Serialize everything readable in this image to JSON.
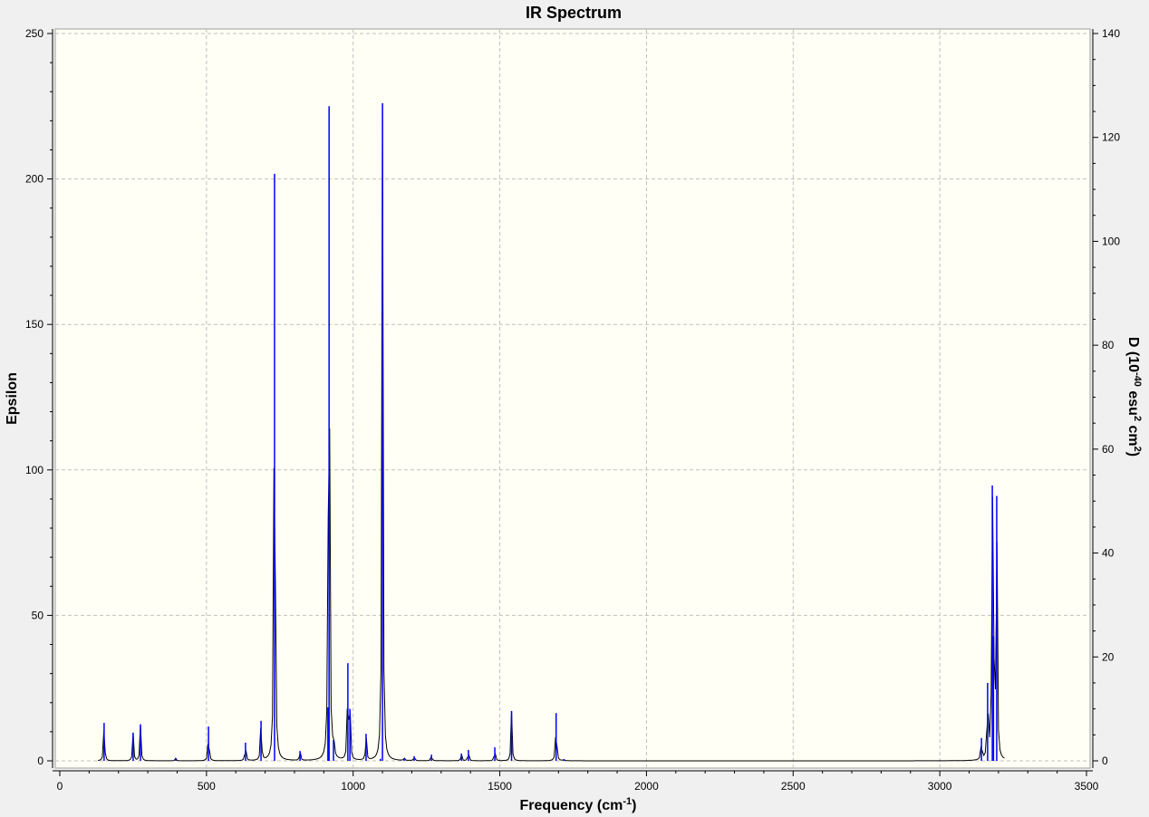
{
  "chart_data": {
    "type": "line",
    "title": "IR Spectrum",
    "xlabel": "Frequency (cm",
    "xlabel_sup": "-1",
    "xlabel_end": ")",
    "ylabel": "Epsilon",
    "y2label_parts": [
      "D (10",
      "-40",
      " esu",
      "2",
      " cm",
      "2",
      ")"
    ],
    "xlim": [
      0,
      3500
    ],
    "ylim": [
      0,
      250
    ],
    "y2lim": [
      0,
      140
    ],
    "x_ticks": [
      "0",
      "500",
      "1000",
      "1500",
      "2000",
      "2500",
      "3000",
      "3500"
    ],
    "x_tick_values": [
      0,
      500,
      1000,
      1500,
      2000,
      2500,
      3000,
      3500
    ],
    "y_ticks": [
      "0",
      "50",
      "100",
      "150",
      "200",
      "250"
    ],
    "y_tick_values": [
      0,
      50,
      100,
      150,
      200,
      250
    ],
    "y2_ticks": [
      "0",
      "20",
      "40",
      "60",
      "80",
      "100",
      "120",
      "140"
    ],
    "y2_tick_values": [
      0,
      20,
      40,
      60,
      80,
      100,
      120,
      140
    ],
    "grid": true,
    "colors": {
      "sticks": "#0000ff",
      "spectrum": "#000000",
      "plot_bg": "#fffff5",
      "grid": "#c0c0c0"
    },
    "spectrum": {
      "name": "Epsilon",
      "axis": "left",
      "range": [
        130,
        3220
      ],
      "step": 5,
      "hwhm": 2,
      "scale": 1.78
    },
    "sticks": {
      "name": "D (10^-40 esu^2 cm^2)",
      "axis": "right",
      "frequency": [
        151,
        250,
        275,
        395,
        507,
        633,
        686,
        732,
        819,
        914,
        918,
        933,
        982,
        989,
        1044,
        1093,
        1100,
        1174,
        1208,
        1267,
        1369,
        1393,
        1483,
        1540,
        1692,
        1718,
        3142,
        3163,
        3179,
        3183,
        3194
      ],
      "intensity": [
        7.3,
        5.4,
        7.0,
        0.5,
        6.6,
        3.5,
        7.7,
        113,
        1.9,
        10.3,
        126,
        4.0,
        18.8,
        10,
        5.2,
        0.4,
        126.6,
        0.5,
        0.9,
        1.2,
        1.4,
        2.1,
        2.6,
        9.6,
        9.2,
        0.3,
        4.4,
        15,
        53,
        24,
        51
      ]
    }
  }
}
